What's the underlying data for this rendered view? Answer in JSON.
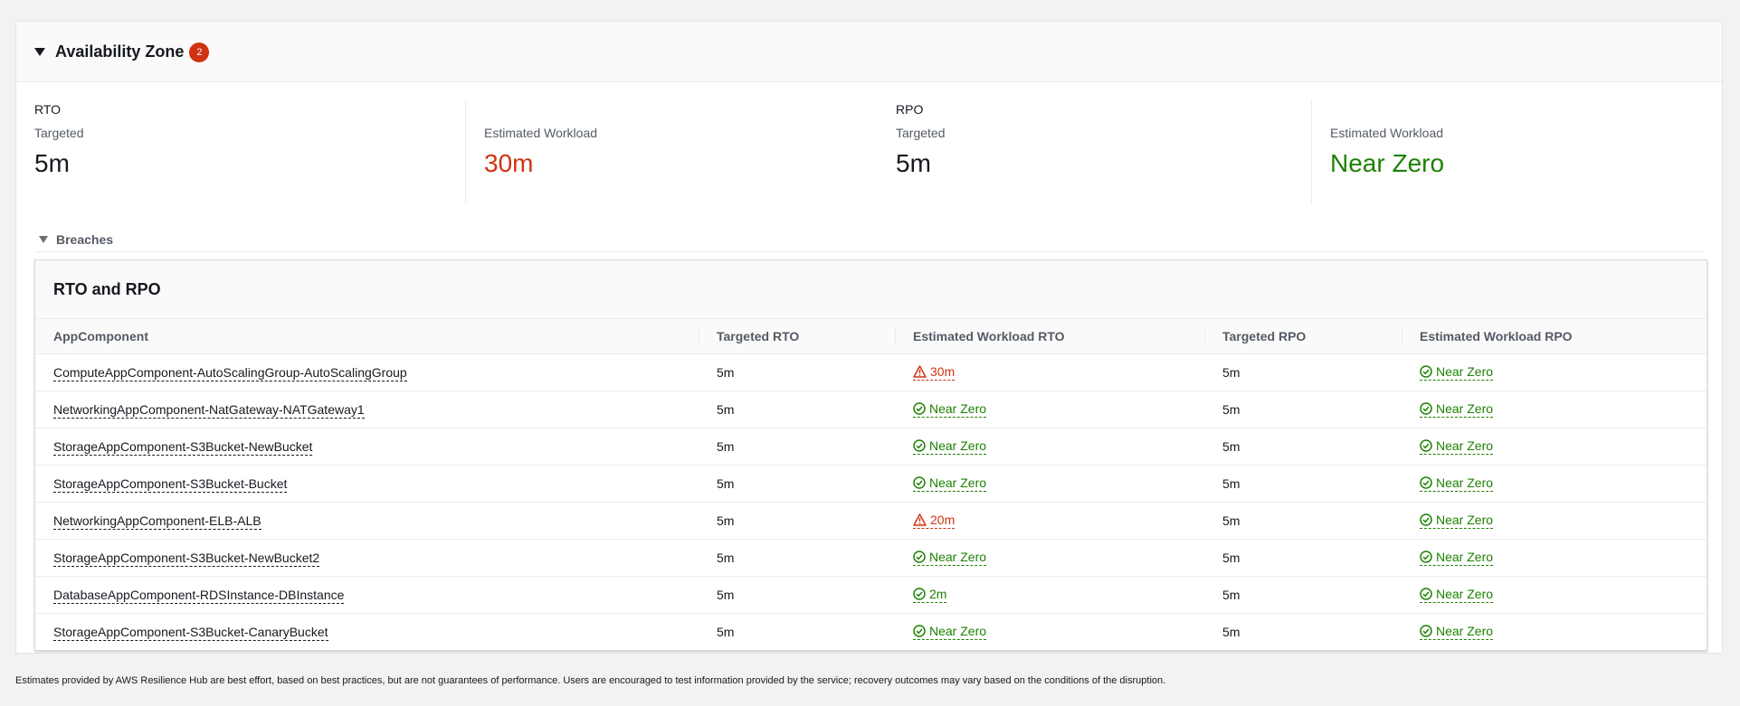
{
  "section": {
    "title": "Availability Zone",
    "badge_count": "2"
  },
  "metrics": {
    "rto": {
      "group_label": "RTO",
      "targeted_label": "Targeted",
      "targeted_value": "5m",
      "estimated_label": "Estimated Workload",
      "estimated_value": "30m"
    },
    "rpo": {
      "group_label": "RPO",
      "targeted_label": "Targeted",
      "targeted_value": "5m",
      "estimated_label": "Estimated Workload",
      "estimated_value": "Near Zero"
    }
  },
  "breaches": {
    "label": "Breaches"
  },
  "table": {
    "title": "RTO and RPO",
    "columns": [
      "AppComponent",
      "Targeted RTO",
      "Estimated Workload RTO",
      "Targeted RPO",
      "Estimated Workload RPO"
    ],
    "rows": [
      {
        "component": "ComputeAppComponent-AutoScalingGroup-AutoScalingGroup",
        "targeted_rto": "5m",
        "est_rto": "30m",
        "est_rto_status": "warn",
        "targeted_rpo": "5m",
        "est_rpo": "Near Zero",
        "est_rpo_status": "ok"
      },
      {
        "component": "NetworkingAppComponent-NatGateway-NATGateway1",
        "targeted_rto": "5m",
        "est_rto": "Near Zero",
        "est_rto_status": "ok",
        "targeted_rpo": "5m",
        "est_rpo": "Near Zero",
        "est_rpo_status": "ok"
      },
      {
        "component": "StorageAppComponent-S3Bucket-NewBucket",
        "targeted_rto": "5m",
        "est_rto": "Near Zero",
        "est_rto_status": "ok",
        "targeted_rpo": "5m",
        "est_rpo": "Near Zero",
        "est_rpo_status": "ok"
      },
      {
        "component": "StorageAppComponent-S3Bucket-Bucket",
        "targeted_rto": "5m",
        "est_rto": "Near Zero",
        "est_rto_status": "ok",
        "targeted_rpo": "5m",
        "est_rpo": "Near Zero",
        "est_rpo_status": "ok"
      },
      {
        "component": "NetworkingAppComponent-ELB-ALB",
        "targeted_rto": "5m",
        "est_rto": "20m",
        "est_rto_status": "warn",
        "targeted_rpo": "5m",
        "est_rpo": "Near Zero",
        "est_rpo_status": "ok"
      },
      {
        "component": "StorageAppComponent-S3Bucket-NewBucket2",
        "targeted_rto": "5m",
        "est_rto": "Near Zero",
        "est_rto_status": "ok",
        "targeted_rpo": "5m",
        "est_rpo": "Near Zero",
        "est_rpo_status": "ok"
      },
      {
        "component": "DatabaseAppComponent-RDSInstance-DBInstance",
        "targeted_rto": "5m",
        "est_rto": "2m",
        "est_rto_status": "ok",
        "targeted_rpo": "5m",
        "est_rpo": "Near Zero",
        "est_rpo_status": "ok"
      },
      {
        "component": "StorageAppComponent-S3Bucket-CanaryBucket",
        "targeted_rto": "5m",
        "est_rto": "Near Zero",
        "est_rto_status": "ok",
        "targeted_rpo": "5m",
        "est_rpo": "Near Zero",
        "est_rpo_status": "ok"
      }
    ]
  },
  "footer": {
    "note": "Estimates provided by AWS Resilience Hub are best effort, based on best practices, but are not guarantees of performance. Users are encouraged to test information provided by the service; recovery outcomes may vary based on the conditions of the disruption."
  },
  "colors": {
    "warning": "#d13212",
    "success": "#1d8102",
    "badge": "#d13212"
  },
  "icons": {
    "ok": "check-circle-icon",
    "warn": "warning-triangle-icon"
  }
}
